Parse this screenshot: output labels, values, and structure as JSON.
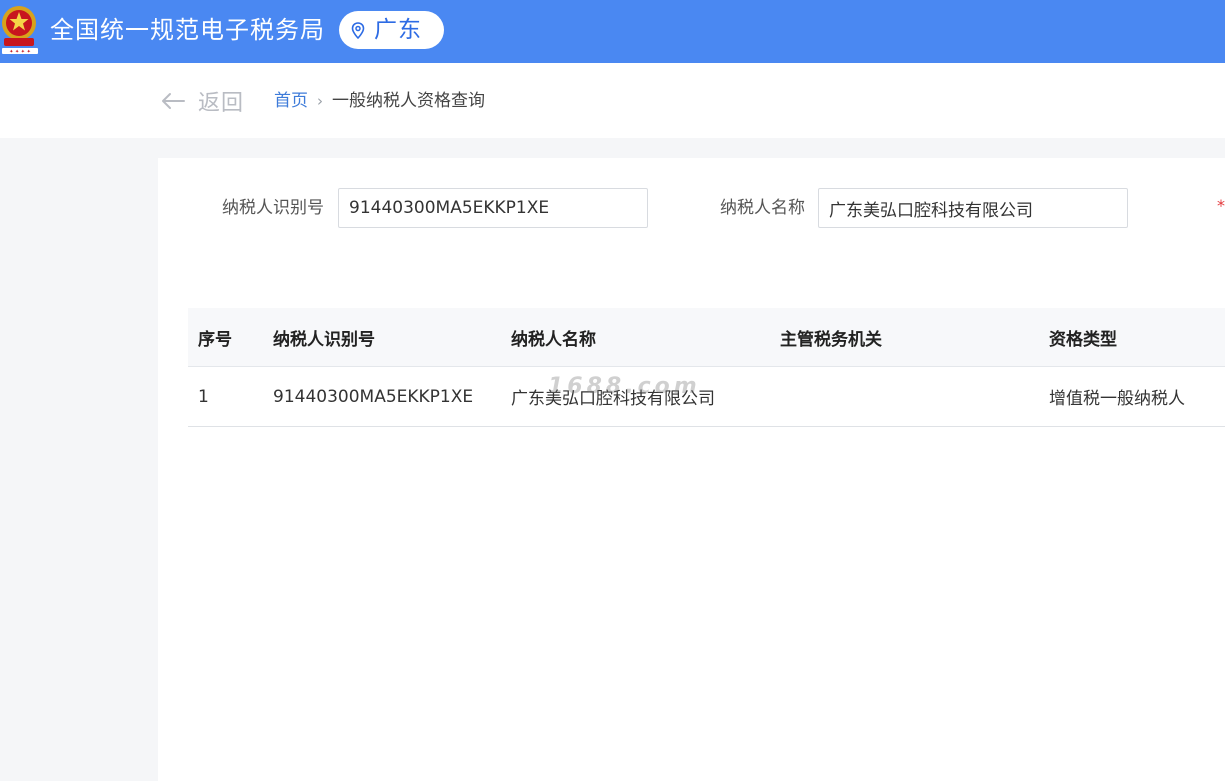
{
  "header": {
    "site_title": "全国统一规范电子税务局",
    "region": "广东",
    "emblem_icon": "tax-emblem-icon",
    "pin_icon": "location-pin-icon",
    "background_color": "#4a88f2"
  },
  "subbar": {
    "back_label": "返回",
    "back_icon": "arrow-left-icon",
    "breadcrumb": {
      "home": "首页",
      "separator": "›",
      "current": "一般纳税人资格查询"
    }
  },
  "form": {
    "taxpayer_id_label": "纳税人识别号",
    "taxpayer_id_value": "91440300MA5EKKP1XE",
    "taxpayer_name_label": "纳税人名称",
    "taxpayer_name_value": "广东美弘口腔科技有限公司",
    "required_mark": "*"
  },
  "table": {
    "columns": [
      "序号",
      "纳税人识别号",
      "纳税人名称",
      "主管税务机关",
      "资格类型"
    ],
    "rows": [
      [
        "1",
        "91440300MA5EKKP1XE",
        "广东美弘口腔科技有限公司",
        "",
        "增值税一般纳税人"
      ]
    ]
  },
  "watermark": "1688.com"
}
